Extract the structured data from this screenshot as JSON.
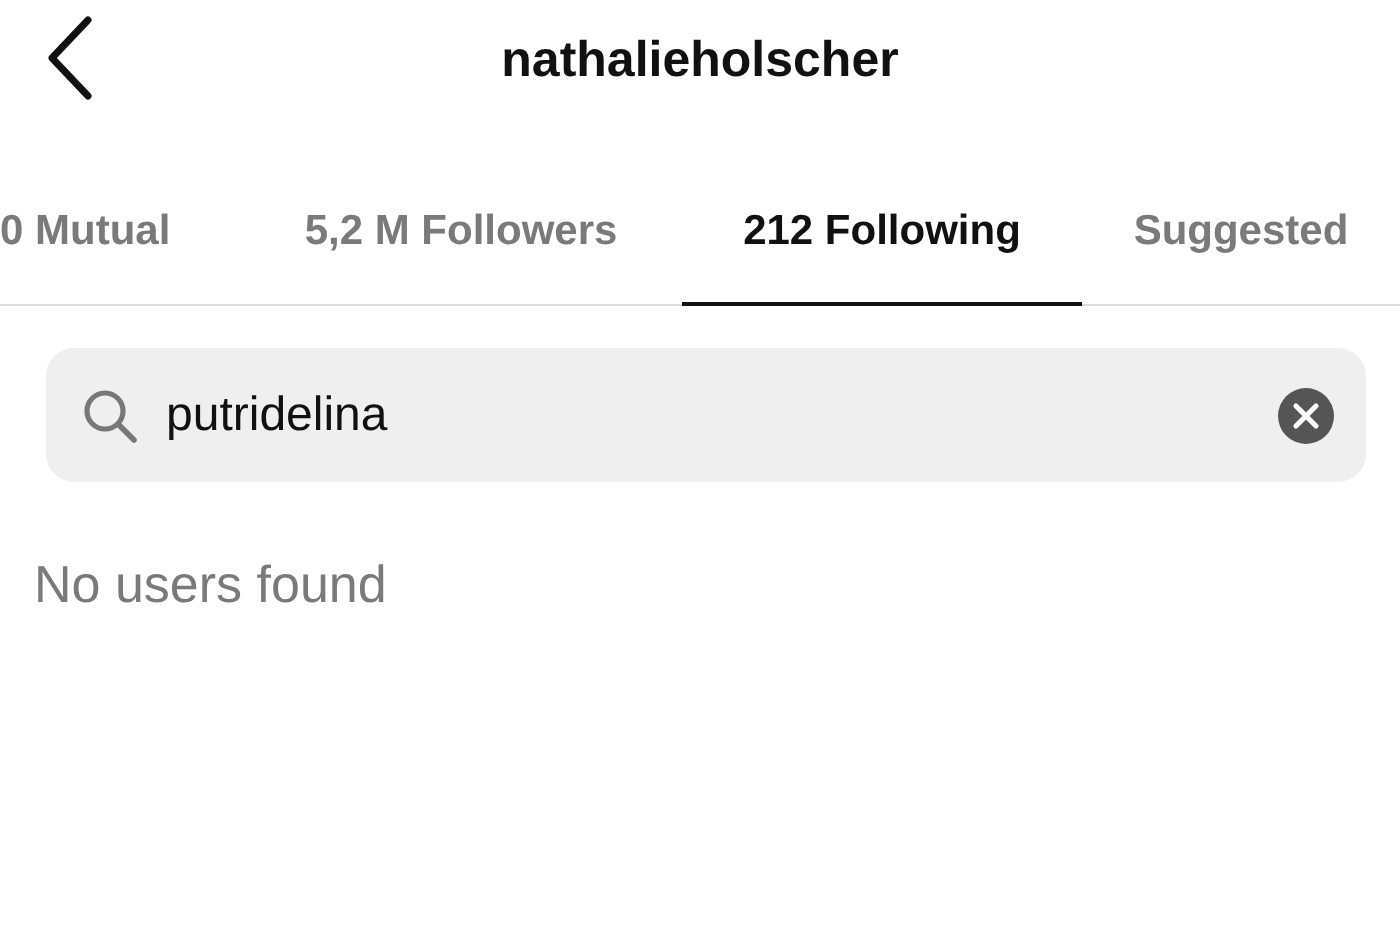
{
  "header": {
    "title": "nathalieholscher"
  },
  "tabs": [
    {
      "label": "0 Mutual",
      "selected": false
    },
    {
      "label": "5,2 M Followers",
      "selected": false
    },
    {
      "label": "212 Following",
      "selected": true
    },
    {
      "label": "Suggested",
      "selected": false
    }
  ],
  "search": {
    "value": "putridelina"
  },
  "message": "No users found"
}
